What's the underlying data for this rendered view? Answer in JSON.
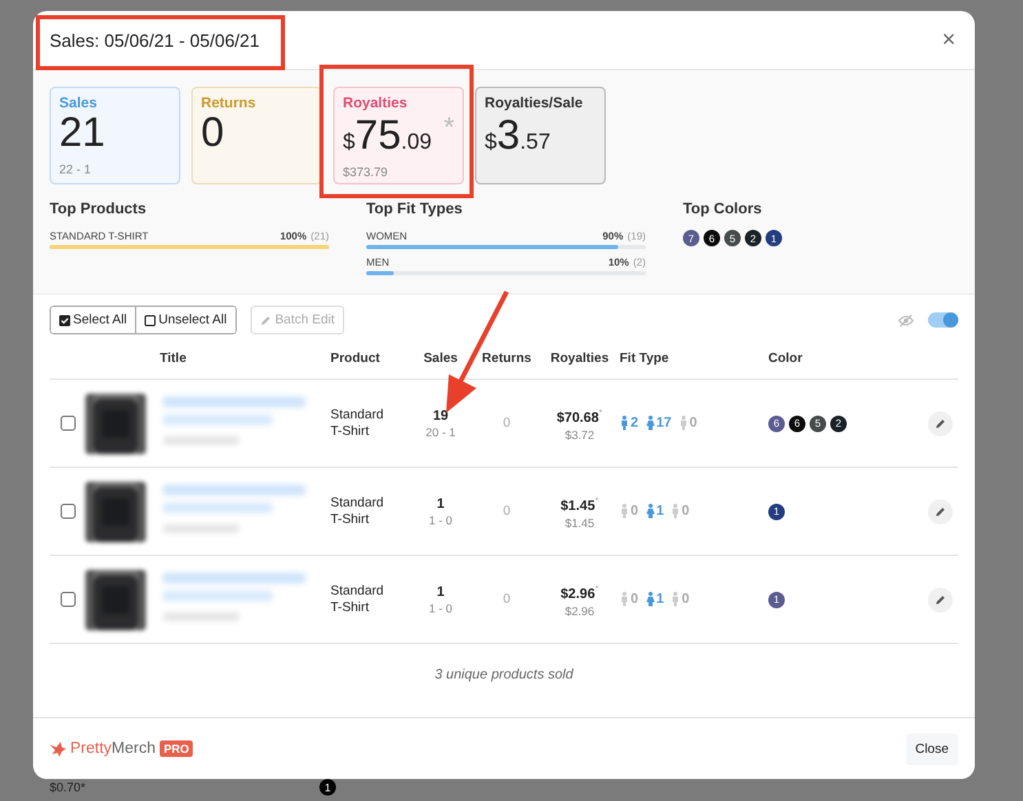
{
  "backdrop": {
    "bottom_price": "$0.70*",
    "bottom_badge": "1"
  },
  "modal": {
    "title": "Sales: 05/06/21 - 05/06/21",
    "close": "×"
  },
  "cards": [
    {
      "kind": "count",
      "color": "#4a98dc",
      "label": "Sales",
      "value": "21",
      "sub": "22 - 1"
    },
    {
      "kind": "count",
      "color": "#cc9a2c",
      "label": "Returns",
      "value": "0"
    },
    {
      "kind": "money",
      "color": "#e04d72",
      "label": "Royalties",
      "currency": "$",
      "whole": "75",
      "fraction": ".09",
      "mark": "*",
      "sub": "$373.79"
    },
    {
      "kind": "money",
      "color": "#333333",
      "label": "Royalties/Sale",
      "currency": "$",
      "whole": "3",
      "fraction": ".57"
    }
  ],
  "top_products": {
    "title": "Top Products",
    "items": [
      {
        "name": "STANDARD T-SHIRT",
        "percent": "100%",
        "count": "(21)",
        "level": 1.0,
        "color": "#f7d37a"
      }
    ]
  },
  "top_fit_types": {
    "title": "Top Fit Types",
    "items": [
      {
        "name": "WOMEN",
        "percent": "90%",
        "count": "(19)",
        "level": 0.9,
        "color": "#6fb2ec"
      },
      {
        "name": "MEN",
        "percent": "10%",
        "count": "(2)",
        "level": 0.1,
        "color": "#6fb2ec"
      }
    ]
  },
  "top_colors": {
    "title": "Top Colors",
    "items": [
      {
        "label": "7",
        "color": "#5b5c8f"
      },
      {
        "label": "6",
        "color": "#0c0c0c"
      },
      {
        "label": "5",
        "color": "#464b4b"
      },
      {
        "label": "2",
        "color": "#1b2227"
      },
      {
        "label": "1",
        "color": "#233d7e"
      }
    ]
  },
  "toolbar": {
    "select_all": "Select All",
    "unselect_all": "Unselect All",
    "batch_edit": "Batch Edit",
    "batch_edit_disabled": true,
    "toggle_on": true
  },
  "table": {
    "columns": [
      "Title",
      "Product",
      "Sales",
      "Returns",
      "Royalties",
      "Fit Type",
      "Color"
    ],
    "rows": [
      {
        "checked": false,
        "product": [
          "Standard",
          "T-Shirt"
        ],
        "sales": "19",
        "sales_detail": "20 - 1",
        "returns": "0",
        "royalties": "$70.68",
        "royalties_mark": "*",
        "royalties_detail": "$3.72",
        "fit": [
          {
            "kind": "men",
            "count": "2",
            "active": true
          },
          {
            "kind": "women",
            "count": "17",
            "active": true
          },
          {
            "kind": "kids",
            "count": "0",
            "active": false
          }
        ],
        "colors": [
          {
            "label": "6",
            "color": "#5b5c8f"
          },
          {
            "label": "6",
            "color": "#0c0c0c"
          },
          {
            "label": "5",
            "color": "#464b4b"
          },
          {
            "label": "2",
            "color": "#1b2227"
          }
        ]
      },
      {
        "checked": false,
        "product": [
          "Standard",
          "T-Shirt"
        ],
        "sales": "1",
        "sales_detail": "1 - 0",
        "returns": "0",
        "royalties": "$1.45",
        "royalties_mark": "*",
        "royalties_detail": "$1.45",
        "fit": [
          {
            "kind": "men",
            "count": "0",
            "active": false
          },
          {
            "kind": "women",
            "count": "1",
            "active": true
          },
          {
            "kind": "kids",
            "count": "0",
            "active": false
          }
        ],
        "colors": [
          {
            "label": "1",
            "color": "#233d7e"
          }
        ]
      },
      {
        "checked": false,
        "product": [
          "Standard",
          "T-Shirt"
        ],
        "sales": "1",
        "sales_detail": "1 - 0",
        "returns": "0",
        "royalties": "$2.96",
        "royalties_mark": "*",
        "royalties_detail": "$2.96",
        "fit": [
          {
            "kind": "men",
            "count": "0",
            "active": false
          },
          {
            "kind": "women",
            "count": "1",
            "active": true
          },
          {
            "kind": "kids",
            "count": "0",
            "active": false
          }
        ],
        "colors": [
          {
            "label": "1",
            "color": "#5b5c8f"
          }
        ]
      }
    ],
    "summary": "3 unique products sold"
  },
  "footer": {
    "brand_first": "Pretty",
    "brand_second": "Merch",
    "badge": "PRO",
    "close": "Close"
  }
}
